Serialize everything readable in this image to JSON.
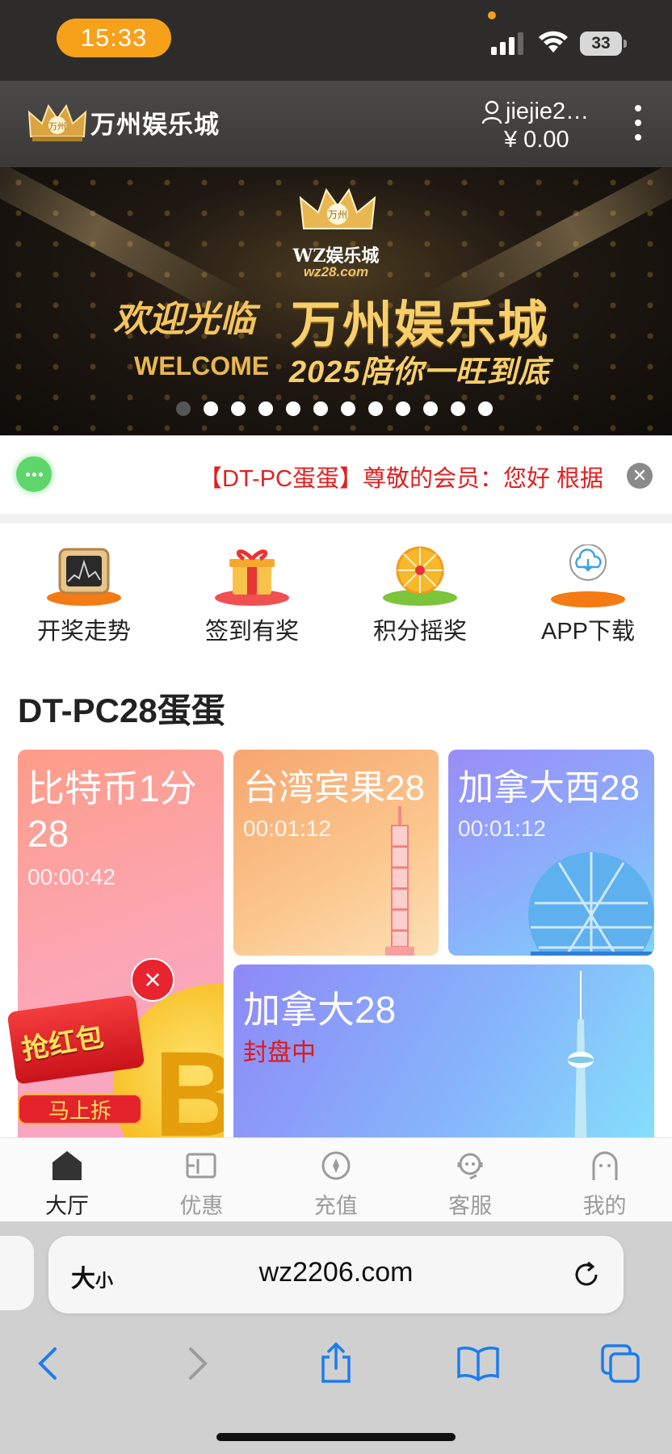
{
  "status_bar": {
    "time": "15:33",
    "battery": "33"
  },
  "header": {
    "logo_text": "万州娱乐城",
    "logo_crown_text": "万州",
    "username": "jiejie2…",
    "balance": "¥ 0.00"
  },
  "banner": {
    "crown_text": "万州",
    "brand": "WZ娱乐城",
    "domain": "wz28.com",
    "welcome_cn": "欢迎光临",
    "title": "万州娱乐城",
    "welcome_en": "WELCOME",
    "slogan": "2025陪你一旺到底",
    "slide_count": 12,
    "active_slide": 0
  },
  "notice": {
    "text": "【DT-PC蛋蛋】尊敬的会员：您好 根据"
  },
  "quick_menu": [
    {
      "label": "开奖走势",
      "icon": "trend-monitor-icon"
    },
    {
      "label": "签到有奖",
      "icon": "gift-box-icon"
    },
    {
      "label": "积分摇奖",
      "icon": "prize-wheel-icon"
    },
    {
      "label": "APP下载",
      "icon": "cloud-download-icon"
    }
  ],
  "section_title": "DT-PC28蛋蛋",
  "games": {
    "btc": {
      "name": "比特币1分28",
      "timer": "00:00:42"
    },
    "taiwan": {
      "name": "台湾宾果28",
      "timer": "00:01:12"
    },
    "canada_west": {
      "name": "加拿大西28",
      "timer": "00:01:12"
    },
    "canada": {
      "name": "加拿大28",
      "status": "封盘中"
    }
  },
  "red_envelope": {
    "title": "抢红包",
    "button": "马上拆",
    "close": "×"
  },
  "tabbar": [
    {
      "label": "大厅",
      "icon": "home-icon",
      "active": true
    },
    {
      "label": "优惠",
      "icon": "coupon-icon",
      "active": false
    },
    {
      "label": "充值",
      "icon": "recharge-icon",
      "active": false
    },
    {
      "label": "客服",
      "icon": "support-icon",
      "active": false
    },
    {
      "label": "我的",
      "icon": "profile-icon",
      "active": false
    }
  ],
  "browser": {
    "text_size_big": "大",
    "text_size_small": "小",
    "url": "wz2206.com"
  },
  "colors": {
    "status_bar_bg": "#2d2c2a",
    "time_pill": "#f7a01a",
    "notice_text": "#e02020",
    "browser_blue": "#1a7cf0"
  }
}
